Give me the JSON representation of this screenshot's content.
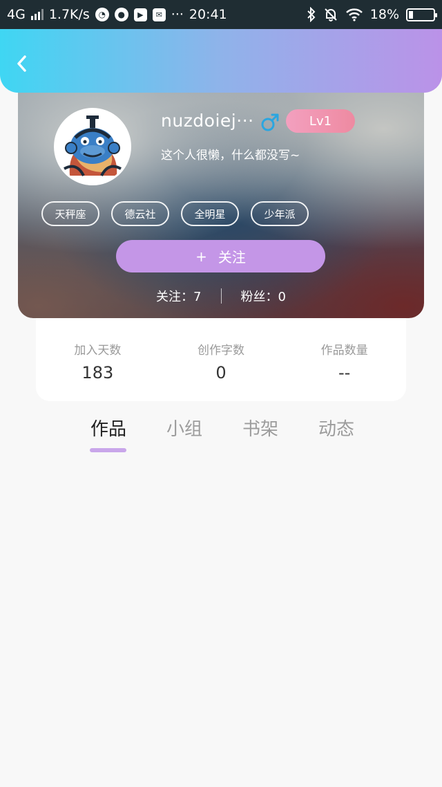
{
  "status_bar": {
    "network": "4G",
    "speed": "1.7K/s",
    "time": "20:41",
    "more": "···",
    "battery": "18%",
    "battery_level": 0.18
  },
  "header": {
    "gradient_start": "#3fd6f3",
    "gradient_end": "#bb92e8"
  },
  "profile": {
    "username": "nuzdoiej···",
    "gender_symbol": "♂",
    "level": "Lv1",
    "bio": "这个人很懒，什么都没写~",
    "tags": [
      "天秤座",
      "德云社",
      "全明星",
      "少年派"
    ],
    "follow_button": {
      "icon": "+",
      "label": "关注"
    },
    "following": "关注：7",
    "followers": "粉丝：0"
  },
  "stats": [
    {
      "label": "加入天数",
      "value": "183"
    },
    {
      "label": "创作字数",
      "value": "0"
    },
    {
      "label": "作品数量",
      "value": "--"
    }
  ],
  "tabs": [
    {
      "label": "作品",
      "active": true
    },
    {
      "label": "小组",
      "active": false
    },
    {
      "label": "书架",
      "active": false
    },
    {
      "label": "动态",
      "active": false
    }
  ],
  "colors": {
    "accent": "#c496e7",
    "level_badge": "#ee8aa1",
    "gender": "#2aa6e0",
    "tab_indicator": "#c9a6ea"
  }
}
